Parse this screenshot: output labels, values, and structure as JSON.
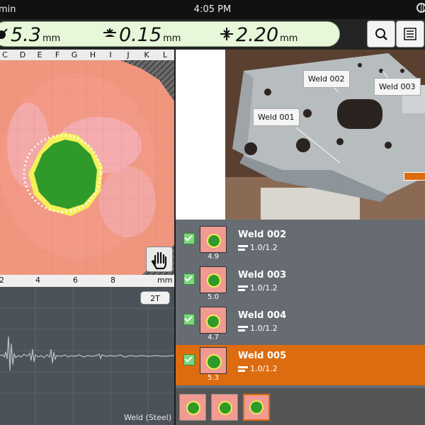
{
  "status": {
    "left_text": "min",
    "time": "4:05 PM"
  },
  "measurements": [
    {
      "icon": "diameter-icon",
      "value": "5.3",
      "unit": "mm"
    },
    {
      "icon": "indentation-icon",
      "value": "0.15",
      "unit": "mm"
    },
    {
      "icon": "thickness-icon",
      "value": "2.20",
      "unit": "mm"
    }
  ],
  "cscan": {
    "columns": [
      "C",
      "D",
      "E",
      "F",
      "G",
      "H",
      "I",
      "J",
      "K",
      "L"
    ]
  },
  "ruler": {
    "ticks": [
      "2",
      "4",
      "6",
      "8"
    ],
    "unit": "mm"
  },
  "ascan": {
    "button": "2T",
    "material": "Weld (Steel)"
  },
  "photo": {
    "callouts": [
      "Weld 002",
      "Weld 003",
      "Weld 001"
    ]
  },
  "welds": [
    {
      "name": "Weld 002",
      "spec": "1.0/1.2",
      "value": "4.9",
      "checked": true,
      "selected": false
    },
    {
      "name": "Weld 003",
      "spec": "1.0/1.2",
      "value": "5.0",
      "checked": true,
      "selected": false
    },
    {
      "name": "Weld 004",
      "spec": "1.0/1.2",
      "value": "4.7",
      "checked": true,
      "selected": false
    },
    {
      "name": "Weld 005",
      "spec": "1.0/1.2",
      "value": "5.3",
      "checked": true,
      "selected": true
    }
  ],
  "colors": {
    "accent": "#dd6c10",
    "measure_bg": "#e7f7d9",
    "checkbox": "#7dd77d"
  }
}
